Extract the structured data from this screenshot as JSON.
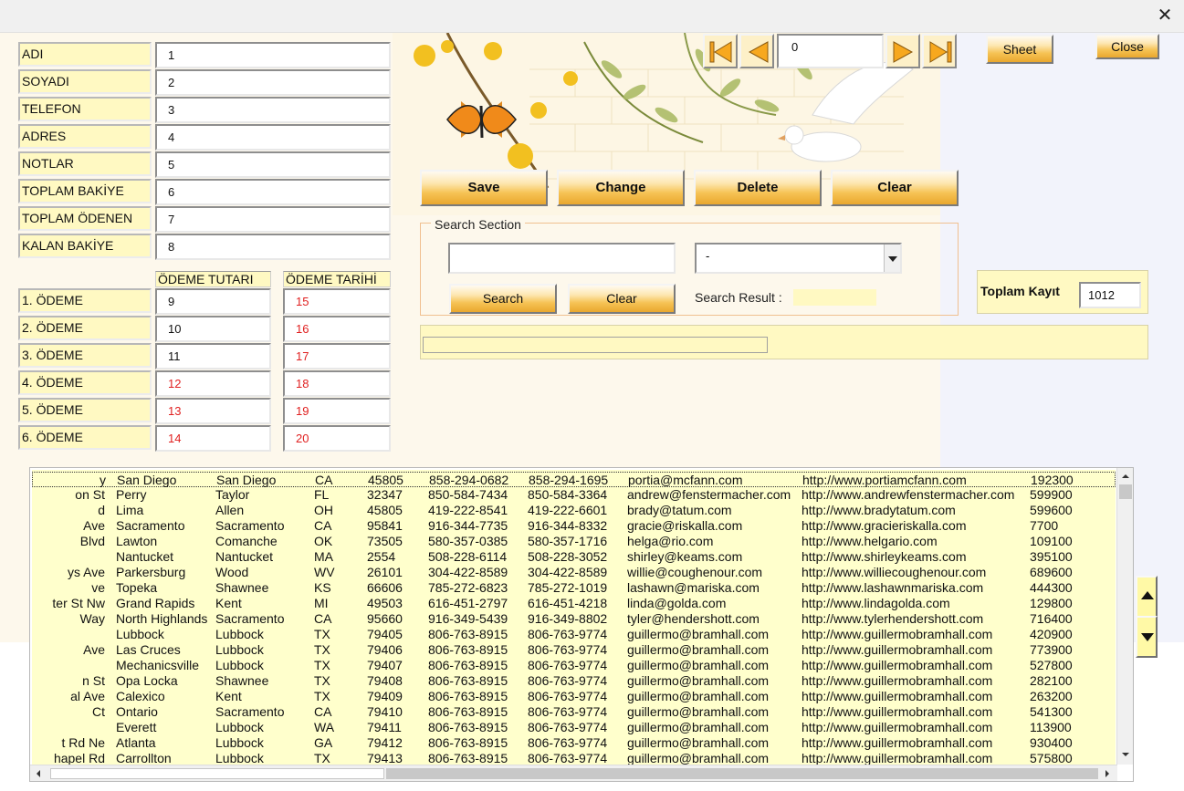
{
  "window": {
    "close_glyph": "✕"
  },
  "fields": [
    {
      "label": "ADI",
      "value": "1"
    },
    {
      "label": "SOYADI",
      "value": "2"
    },
    {
      "label": "TELEFON",
      "value": "3"
    },
    {
      "label": "ADRES",
      "value": "4"
    },
    {
      "label": "NOTLAR",
      "value": "5"
    },
    {
      "label": "TOPLAM BAKİYE",
      "value": "6"
    },
    {
      "label": "TOPLAM ÖDENEN",
      "value": "7"
    },
    {
      "label": "KALAN BAKİYE",
      "value": "8"
    }
  ],
  "payments": {
    "amount_header": "ÖDEME TUTARI",
    "date_header": "ÖDEME TARİHİ",
    "rows": [
      {
        "label": "1. ÖDEME",
        "amount": "9",
        "date": "15"
      },
      {
        "label": "2. ÖDEME",
        "amount": "10",
        "date": "16"
      },
      {
        "label": "3. ÖDEME",
        "amount": "11",
        "date": "17"
      },
      {
        "label": "4. ÖDEME",
        "amount": "12",
        "date": "18"
      },
      {
        "label": "5. ÖDEME",
        "amount": "13",
        "date": "19"
      },
      {
        "label": "6. ÖDEME",
        "amount": "14",
        "date": "20"
      }
    ]
  },
  "nav": {
    "record_value": "0"
  },
  "top_buttons": {
    "sheet": "Sheet",
    "close": "Close"
  },
  "actions": {
    "save": "Save",
    "change": "Change",
    "delete": "Delete",
    "clear": "Clear"
  },
  "search": {
    "title": "Search Section",
    "query": "",
    "field_selected": "-",
    "search_button": "Search",
    "clear_button": "Clear",
    "result_label": "Search Result :",
    "result_value": ""
  },
  "total": {
    "label": "Toplam Kayıt",
    "value": "1012"
  },
  "colors": {
    "form_bg": "#fdf8ec",
    "label_bg": "#fff9c2",
    "red_text": "#e02020",
    "grid_bg": "#ffffcc"
  },
  "grid": {
    "rows": [
      [
        "y",
        "San Diego",
        "San Diego",
        "CA",
        "45805",
        "858-294-0682",
        "858-294-1695",
        "portia@mcfann.com",
        "http://www.portiamcfann.com",
        "192300"
      ],
      [
        "on St",
        "Perry",
        "Taylor",
        "FL",
        "32347",
        "850-584-7434",
        "850-584-3364",
        "andrew@fenstermacher.com",
        "http://www.andrewfenstermacher.com",
        "599900"
      ],
      [
        "d",
        "Lima",
        "Allen",
        "OH",
        "45805",
        "419-222-8541",
        "419-222-6601",
        "brady@tatum.com",
        "http://www.bradytatum.com",
        "599600"
      ],
      [
        "Ave",
        "Sacramento",
        "Sacramento",
        "CA",
        "95841",
        "916-344-7735",
        "916-344-8332",
        "gracie@riskalla.com",
        "http://www.gracieriskalla.com",
        "7700"
      ],
      [
        "Blvd",
        "Lawton",
        "Comanche",
        "OK",
        "73505",
        "580-357-0385",
        "580-357-1716",
        "helga@rio.com",
        "http://www.helgario.com",
        "109100"
      ],
      [
        "",
        "Nantucket",
        "Nantucket",
        "MA",
        "2554",
        "508-228-6114",
        "508-228-3052",
        "shirley@keams.com",
        "http://www.shirleykeams.com",
        "395100"
      ],
      [
        "ys Ave",
        "Parkersburg",
        "Wood",
        "WV",
        "26101",
        "304-422-8589",
        "304-422-8589",
        "willie@coughenour.com",
        "http://www.williecoughenour.com",
        "689600"
      ],
      [
        "ve",
        "Topeka",
        "Shawnee",
        "KS",
        "66606",
        "785-272-6823",
        "785-272-1019",
        "lashawn@mariska.com",
        "http://www.lashawnmariska.com",
        "444300"
      ],
      [
        "ter St Nw",
        "Grand Rapids",
        "Kent",
        "MI",
        "49503",
        "616-451-2797",
        "616-451-4218",
        "linda@golda.com",
        "http://www.lindagolda.com",
        "129800"
      ],
      [
        "Way",
        "North Highlands",
        "Sacramento",
        "CA",
        "95660",
        "916-349-5439",
        "916-349-8802",
        "tyler@hendershott.com",
        "http://www.tylerhendershott.com",
        "716400"
      ],
      [
        "",
        "Lubbock",
        "Lubbock",
        "TX",
        "79405",
        "806-763-8915",
        "806-763-9774",
        "guillermo@bramhall.com",
        "http://www.guillermobramhall.com",
        "420900"
      ],
      [
        "Ave",
        "Las Cruces",
        "Lubbock",
        "TX",
        "79406",
        "806-763-8915",
        "806-763-9774",
        "guillermo@bramhall.com",
        "http://www.guillermobramhall.com",
        "773900"
      ],
      [
        "",
        "Mechanicsville",
        "Lubbock",
        "TX",
        "79407",
        "806-763-8915",
        "806-763-9774",
        "guillermo@bramhall.com",
        "http://www.guillermobramhall.com",
        "527800"
      ],
      [
        "n St",
        "Opa Locka",
        "Shawnee",
        "TX",
        "79408",
        "806-763-8915",
        "806-763-9774",
        "guillermo@bramhall.com",
        "http://www.guillermobramhall.com",
        "282100"
      ],
      [
        "al Ave",
        "Calexico",
        "Kent",
        "TX",
        "79409",
        "806-763-8915",
        "806-763-9774",
        "guillermo@bramhall.com",
        "http://www.guillermobramhall.com",
        "263200"
      ],
      [
        "Ct",
        "Ontario",
        "Sacramento",
        "CA",
        "79410",
        "806-763-8915",
        "806-763-9774",
        "guillermo@bramhall.com",
        "http://www.guillermobramhall.com",
        "541300"
      ],
      [
        "",
        "Everett",
        "Lubbock",
        "WA",
        "79411",
        "806-763-8915",
        "806-763-9774",
        "guillermo@bramhall.com",
        "http://www.guillermobramhall.com",
        "113900"
      ],
      [
        "t Rd Ne",
        "Atlanta",
        "Lubbock",
        "GA",
        "79412",
        "806-763-8915",
        "806-763-9774",
        "guillermo@bramhall.com",
        "http://www.guillermobramhall.com",
        "930400"
      ],
      [
        "hapel Rd",
        "Carrollton",
        "Lubbock",
        "TX",
        "79413",
        "806-763-8915",
        "806-763-9774",
        "guillermo@bramhall.com",
        "http://www.guillermobramhall.com",
        "575800"
      ]
    ]
  }
}
